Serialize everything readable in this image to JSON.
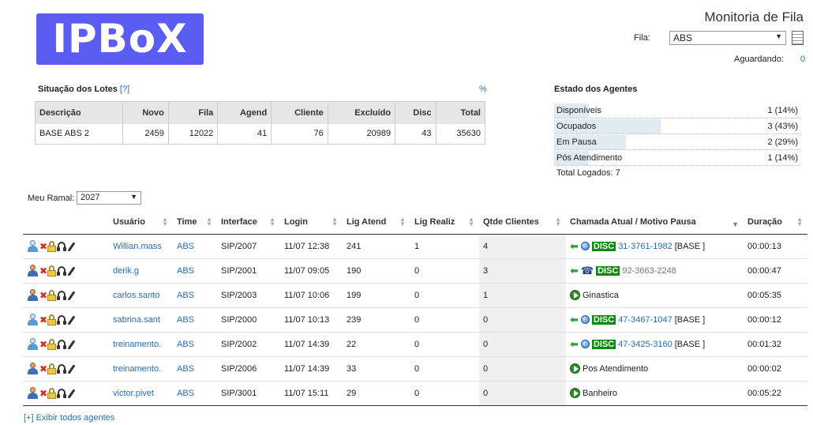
{
  "logo": {
    "text": "IPBoX",
    "color": "#5a5cf2"
  },
  "header": {
    "title": "Monitoria de Fila",
    "fila_label": "Fila:",
    "fila_value": "ABS",
    "aguardando_label": "Aguardando:",
    "aguardando_value": "0"
  },
  "lotes": {
    "title": "Situação dos Lotes",
    "help": "[?]",
    "pct_link": "%",
    "columns": [
      "Descrição",
      "Novo",
      "Fila",
      "Agend",
      "Cliente",
      "Excluído",
      "Disc",
      "Total"
    ],
    "rows": [
      [
        "BASE ABS 2",
        "2459",
        "12022",
        "41",
        "76",
        "20989",
        "43",
        "35630"
      ]
    ]
  },
  "estado": {
    "title": "Estado dos Agentes",
    "items": [
      {
        "name": "Disponíveis",
        "value": "1 (14%)",
        "fraction": 0.14
      },
      {
        "name": "Ocupados",
        "value": "3 (43%)",
        "fraction": 0.43
      },
      {
        "name": "Em Pausa",
        "value": "2 (29%)",
        "fraction": 0.29
      },
      {
        "name": "Pós Atendimento",
        "value": "1 (14%)",
        "fraction": 0.14
      }
    ],
    "total": "Total Logados: 7"
  },
  "ramal": {
    "label": "Meu Ramal:",
    "value": "2027"
  },
  "agents": {
    "columns": [
      "Usuário",
      "Time",
      "Interface",
      "Login",
      "Lig Atend",
      "Lig Realiz",
      "Qtde Clientes",
      "Chamada Atual / Motivo Pausa",
      "Duração"
    ],
    "rows": [
      {
        "usuario": "Willian.mass",
        "time": "ABS",
        "interface": "SIP/2007",
        "login": "11/07 12:38",
        "atend": "241",
        "realiz": "1",
        "clientes": "4",
        "mode": "call",
        "media": "globe",
        "disc": "DISC",
        "numero": "31-3761-1982",
        "extra": "[BASE ]",
        "duracao": "00:00:13",
        "icon": "alt"
      },
      {
        "usuario": "derik.g",
        "time": "ABS",
        "interface": "SIP/2001",
        "login": "11/07 09:05",
        "atend": "190",
        "realiz": "0",
        "clientes": "3",
        "mode": "call",
        "media": "phone",
        "disc": "DISC",
        "numero": "92-3663-2248",
        "extra": "",
        "duracao": "00:00:47",
        "icon": "normal"
      },
      {
        "usuario": "carlos.santo",
        "time": "ABS",
        "interface": "SIP/2003",
        "login": "11/07 10:06",
        "atend": "199",
        "realiz": "0",
        "clientes": "1",
        "mode": "pause",
        "motivo": "Ginastica",
        "duracao": "00:05:35",
        "icon": "normal"
      },
      {
        "usuario": "sabrina.sant",
        "time": "ABS",
        "interface": "SIP/2000",
        "login": "11/07 10:13",
        "atend": "239",
        "realiz": "0",
        "clientes": "0",
        "mode": "call",
        "media": "globe",
        "disc": "DISC",
        "numero": "47-3467-1047",
        "extra": "[BASE ]",
        "duracao": "00:00:12",
        "icon": "alt"
      },
      {
        "usuario": "treinamento.",
        "time": "ABS",
        "interface": "SIP/2002",
        "login": "11/07 14:39",
        "atend": "22",
        "realiz": "0",
        "clientes": "0",
        "mode": "call",
        "media": "globe",
        "disc": "DISC",
        "numero": "47-3425-3160",
        "extra": "[BASE ]",
        "duracao": "00:01:32",
        "icon": "alt"
      },
      {
        "usuario": "treinamento.",
        "time": "ABS",
        "interface": "SIP/2006",
        "login": "11/07 14:39",
        "atend": "33",
        "realiz": "0",
        "clientes": "0",
        "mode": "pause",
        "motivo": "Pos Atendimento",
        "duracao": "00:00:02",
        "icon": "normal"
      },
      {
        "usuario": "victor.pivet",
        "time": "ABS",
        "interface": "SIP/3001",
        "login": "11/07 15:11",
        "atend": "29",
        "realiz": "0",
        "clientes": "0",
        "mode": "pause",
        "motivo": "Banheiro",
        "duracao": "00:05:22",
        "icon": "normal"
      }
    ]
  },
  "footer": {
    "show_all": "[+] Exibir todos agentes"
  }
}
